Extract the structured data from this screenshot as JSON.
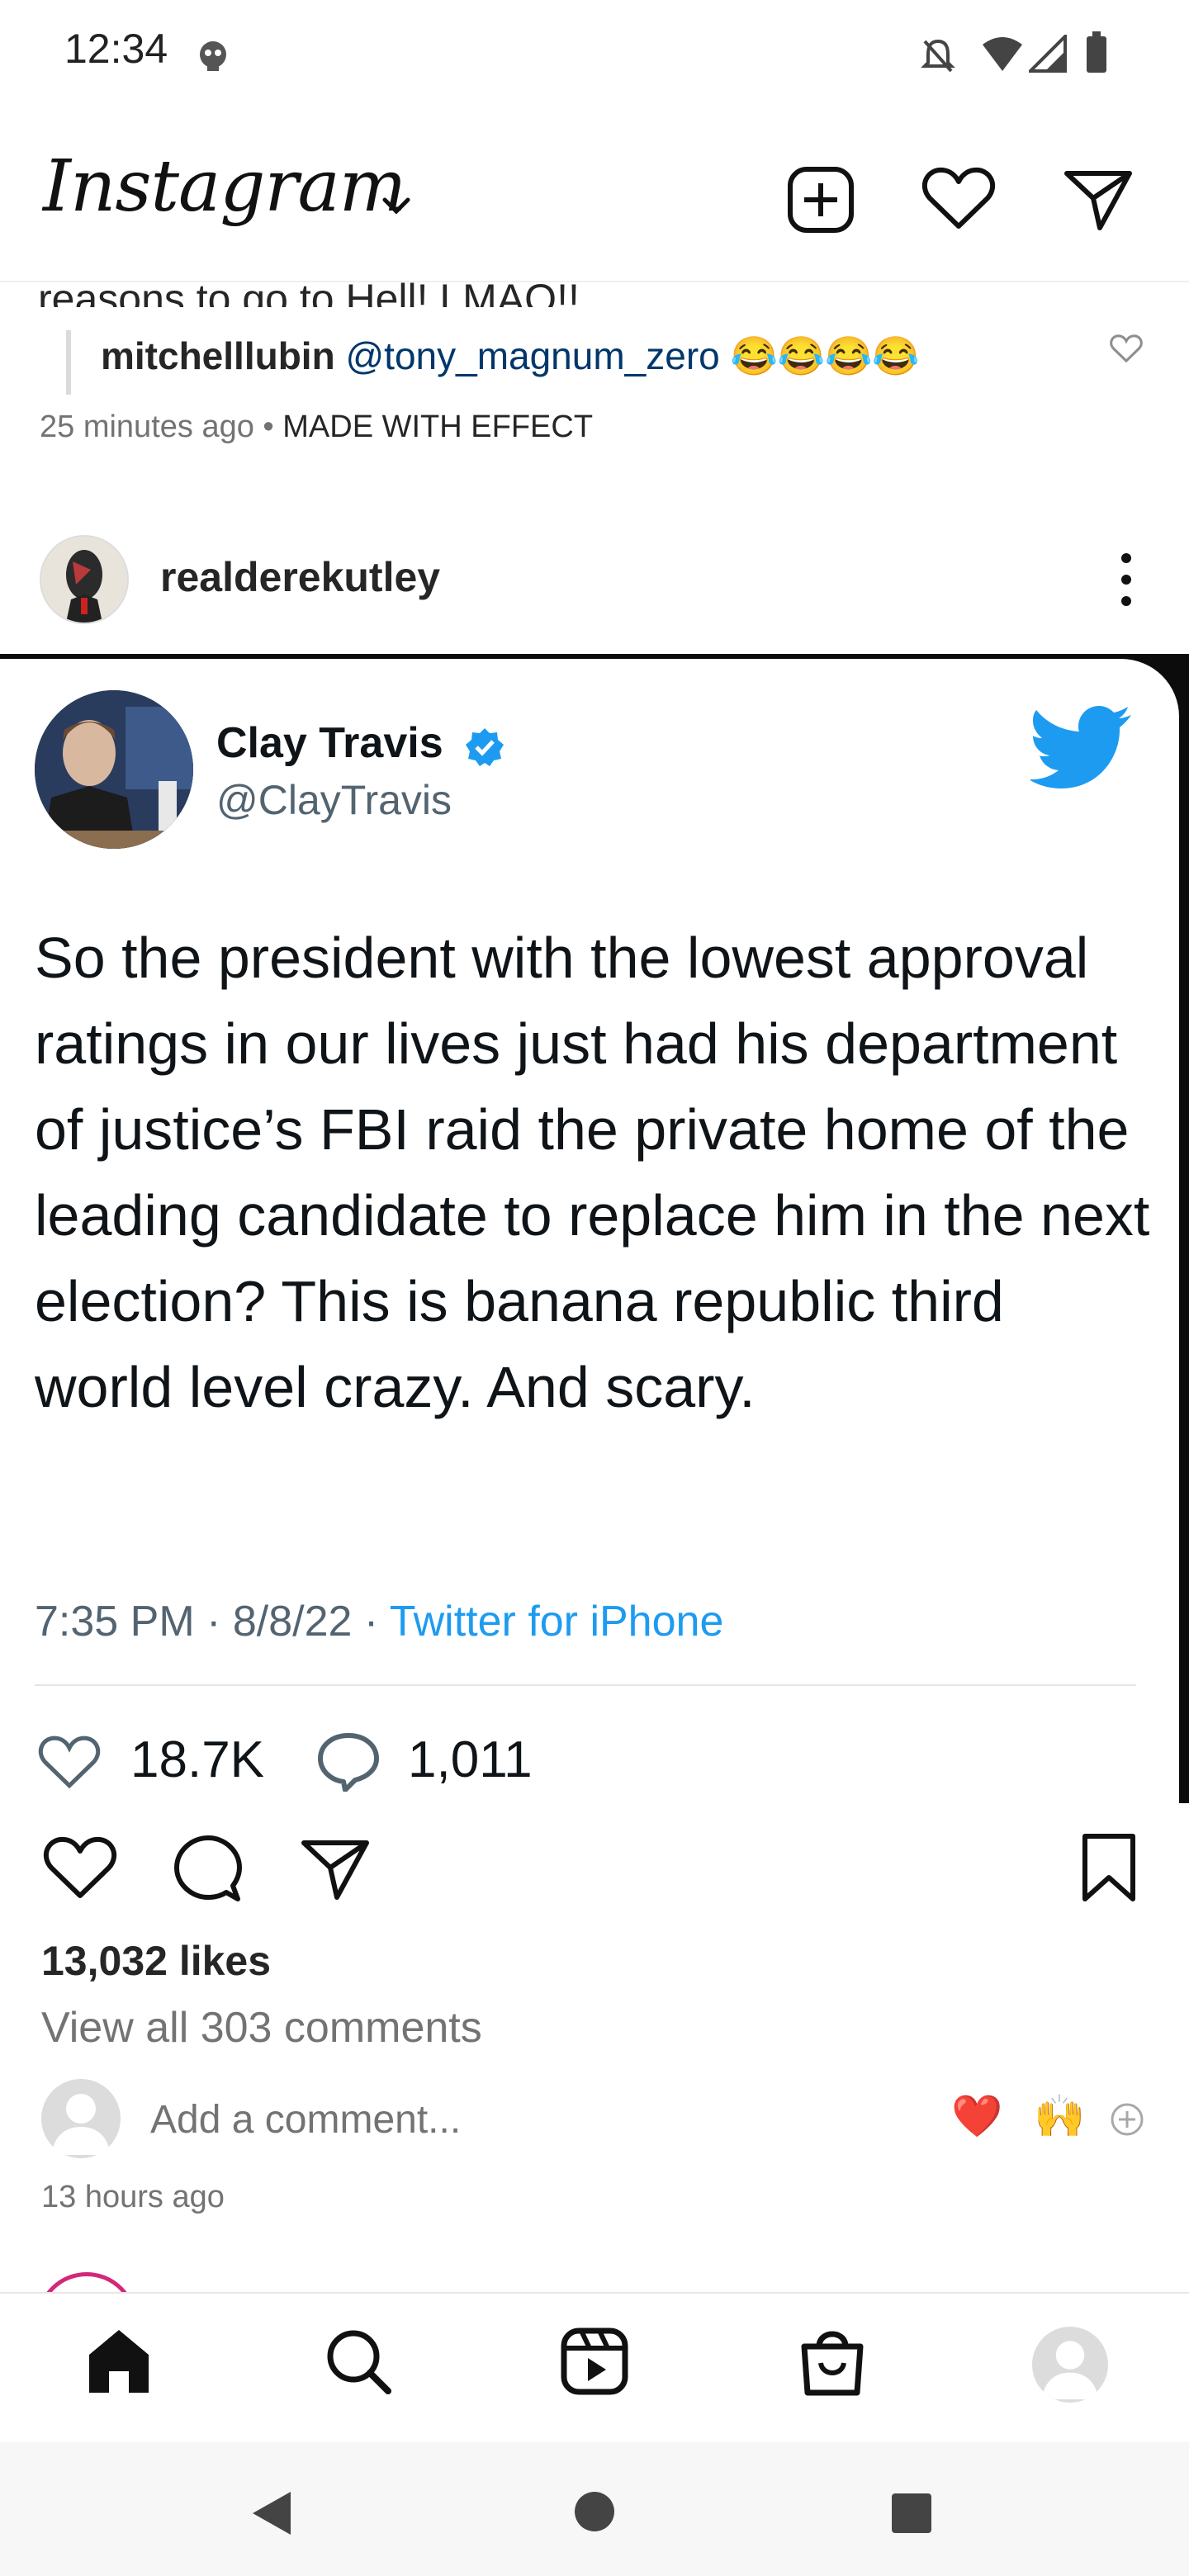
{
  "status_bar": {
    "time": "12:34"
  },
  "header": {
    "logo": "Instagram"
  },
  "comment_preview": {
    "partial_line": "reasons to go to Hell! LMAO!!",
    "reply_user": "mitchelllubin",
    "reply_mention": "@tony_magnum_zero",
    "reply_emoji": "😂😂😂😂",
    "time": "25 minutes ago",
    "separator": "•",
    "effect": "MADE WITH EFFECT"
  },
  "post": {
    "username": "realderekutley",
    "likes": "13,032 likes",
    "view_comments": "View all 303 comments",
    "add_comment_placeholder": "Add a comment...",
    "quick_emoji_1": "❤️",
    "quick_emoji_2": "🙌",
    "time_ago": "13 hours ago"
  },
  "tweet": {
    "name": "Clay Travis",
    "handle": "@ClayTravis",
    "text": "So the president with the lowest approval ratings in our lives just had his department of justice’s FBI raid the private home of the leading candidate to replace him in the next election? This is banana republic third world level crazy. And scary.",
    "time": "7:35 PM",
    "date": "8/8/22",
    "source": "Twitter for iPhone",
    "dot": " · ",
    "likes": "18.7K",
    "replies": "1,011"
  },
  "colors": {
    "twitter_blue": "#1d9bf0",
    "verified_blue": "#1d9bf0",
    "text_primary": "#262626",
    "text_muted": "#737373"
  }
}
